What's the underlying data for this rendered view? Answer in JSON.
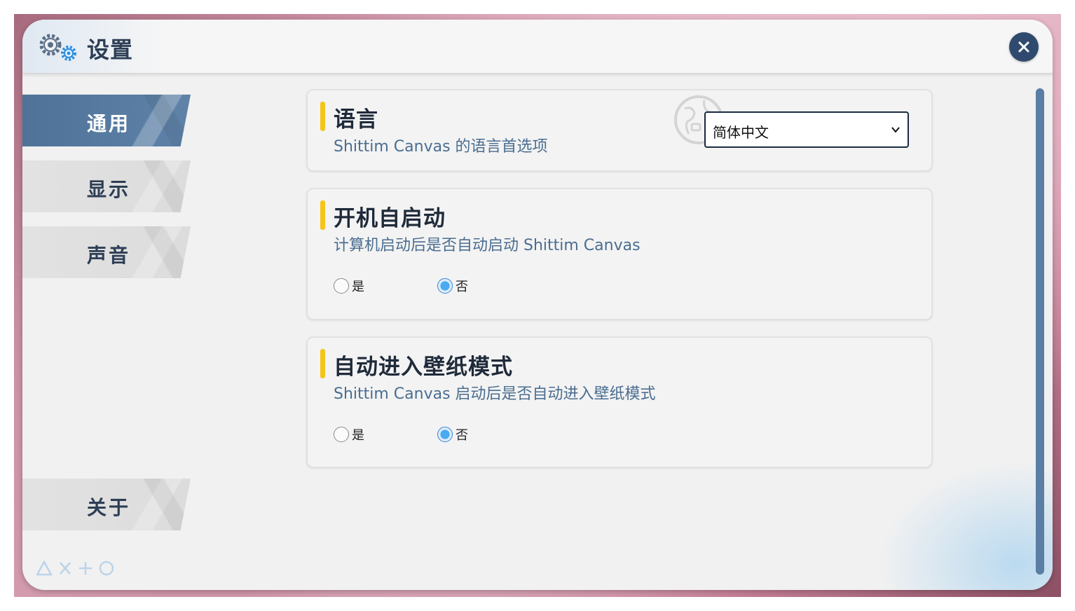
{
  "window": {
    "title": "设置",
    "close_icon": "close-icon",
    "title_icon": "gears-icon"
  },
  "nav": {
    "items": [
      {
        "label": "通用",
        "active": true
      },
      {
        "label": "显示",
        "active": false
      },
      {
        "label": "声音",
        "active": false
      },
      {
        "label": "关于",
        "active": false
      }
    ],
    "footer_symbols": [
      "triangle-icon",
      "cross-icon",
      "plus-icon",
      "circle-icon"
    ]
  },
  "settings": {
    "language": {
      "title": "语言",
      "description": "Shittim Canvas 的语言首选项",
      "selected": "简体中文",
      "icon": "globe-icon"
    },
    "autostart": {
      "title": "开机自启动",
      "description": "计算机启动后是否自动启动 Shittim Canvas",
      "options": [
        "是",
        "否"
      ],
      "selected": "否"
    },
    "wallpaper": {
      "title": "自动进入壁纸模式",
      "description": "Shittim Canvas 启动后是否自动进入壁纸模式",
      "options": [
        "是",
        "否"
      ],
      "selected": "否"
    }
  },
  "colors": {
    "accent_yellow": "#f5c518",
    "nav_active": "#5478a0",
    "title_text": "#2d3e55",
    "desc_text": "#4a6d90",
    "close_bg": "#2f4a6e"
  }
}
